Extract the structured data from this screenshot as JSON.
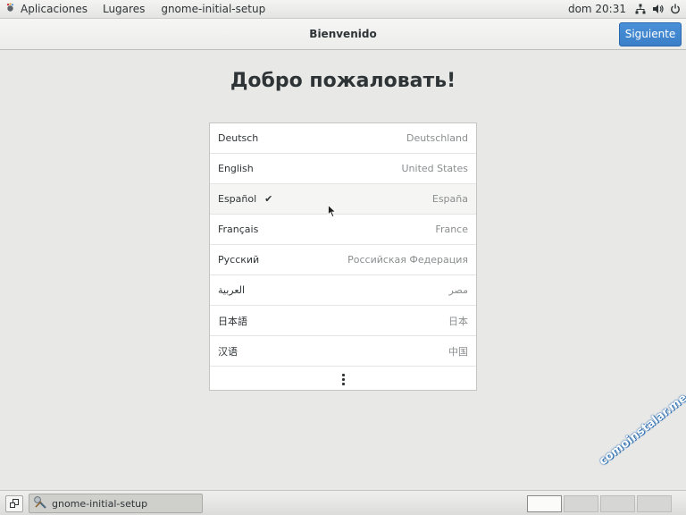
{
  "top_panel": {
    "applications": "Aplicaciones",
    "places": "Lugares",
    "app_menu": "gnome-initial-setup",
    "clock": "dom 20:31",
    "icons": [
      "network-icon",
      "volume-icon",
      "power-icon"
    ]
  },
  "header": {
    "title": "Bienvenido",
    "next_label": "Siguiente",
    "accent": "#4a90d9"
  },
  "main": {
    "welcome": "Добро пожаловать!",
    "languages": [
      {
        "lang": "Deutsch",
        "region": "Deutschland",
        "selected": false
      },
      {
        "lang": "English",
        "region": "United States",
        "selected": false
      },
      {
        "lang": "Español",
        "region": "España",
        "selected": true
      },
      {
        "lang": "Français",
        "region": "France",
        "selected": false
      },
      {
        "lang": "Русский",
        "region": "Российская Федерация",
        "selected": false
      },
      {
        "lang": "العربية",
        "region": "مصر",
        "selected": false
      },
      {
        "lang": "日本語",
        "region": "日本",
        "selected": false
      },
      {
        "lang": "汉语",
        "region": "中国",
        "selected": false
      }
    ],
    "check_glyph": "✔"
  },
  "watermark": "comoinstalar.me",
  "bottom_panel": {
    "task_label": "gnome-initial-setup",
    "workspaces": 4,
    "active_workspace": 1
  }
}
